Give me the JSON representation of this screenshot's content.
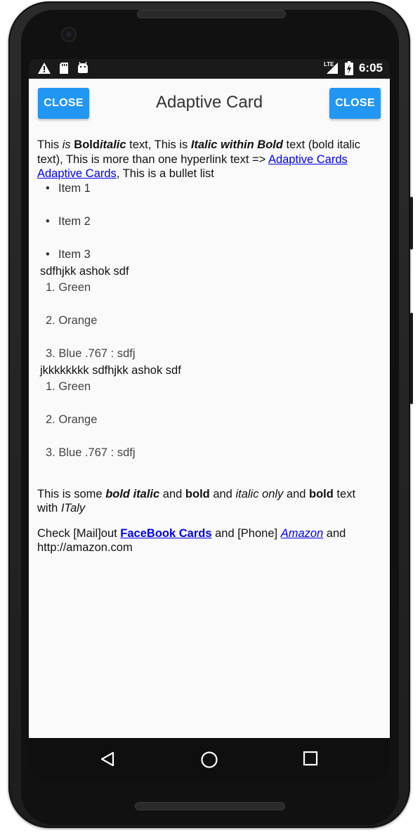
{
  "status": {
    "time": "6:05",
    "network": "LTE"
  },
  "header": {
    "title": "Adaptive Card",
    "close_left": "CLOSE",
    "close_right": "CLOSE"
  },
  "para1": {
    "t1": "This ",
    "t2": "is",
    "t3": " ",
    "t4": "Bold",
    "t5": "italic",
    "t6": " text, This is ",
    "t7": "Italic within Bold",
    "t8": " text (bold italic text), This is more than one hyperlink text => ",
    "link1": "Adaptive Cards",
    "t9": " ",
    "link2": "Adaptive Cards",
    "t10": ", This is a bullet list"
  },
  "bullets": [
    "Item 1",
    "Item 2",
    "Item 3"
  ],
  "line1": "sdfhjkk ashok sdf",
  "numbered1": [
    "1. Green",
    "2. Orange",
    "3. Blue .767 : sdfj"
  ],
  "line2": "jkkkkkkkk sdfhjkk ashok sdf",
  "numbered2": [
    "1. Green",
    "2. Orange",
    "3. Blue .767 : sdfj"
  ],
  "para2": {
    "t1": "This is some ",
    "t2": "bold italic",
    "t3": " and ",
    "t4": "bold",
    "t5": " and ",
    "t6": "italic only",
    "t7": " and ",
    "t8": "bold",
    "t9": " text with ",
    "t10": "ITaly"
  },
  "para3": {
    "t1": "Check [Mail]out ",
    "link1": "FaceBook Cards",
    "t2": " and [Phone] ",
    "link2": "Amazon",
    "t3": " and http://amazon.com"
  }
}
